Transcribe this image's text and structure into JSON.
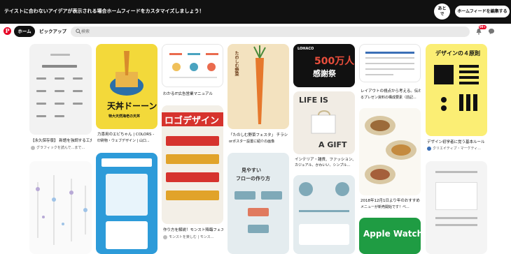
{
  "banner": {
    "message": "テイストに合わないアイデアが表示される場合ホームフィードをカスタマイズしましょう！",
    "later": "あと\nで",
    "edit": "ホームフィードを編集する"
  },
  "nav": {
    "home": "ホーム",
    "pickup": "ピックアップ",
    "search_placeholder": "検索",
    "notifications": "99+"
  },
  "pins": [
    {
      "id": "p1",
      "title": "【永久保存版】 新語を強調する工夫 ...",
      "meta": "グラフィックを読んで...まで...",
      "bg": "#f2f2f2"
    },
    {
      "id": "p2",
      "title": "力喜用のエビちゃん | COLORS -",
      "meta": "印刷物・ウェブデザイン | 山口...",
      "bg": "#f3d93a",
      "art_title": "天丼ドーーン",
      "art_sub": "特大天然海老の天丼"
    },
    {
      "id": "p3",
      "title": "わかるIT広告営業マニュアル",
      "bg": "#ffffff"
    },
    {
      "id": "p4",
      "title": "「たのしむ野菜フェスタ」 チラシ",
      "meta": "orポスター設置に紹介の画像",
      "bg": "#f3e2bf",
      "art_title": "たのしむ野菜"
    },
    {
      "id": "p5",
      "title": "",
      "bg": "#111111",
      "art_title": "500万人",
      "art_sub": "感謝祭",
      "art_brand": "LOHACO"
    },
    {
      "id": "p6",
      "title": "レイアウトの視点から考える。伝わ",
      "meta": "るプレゼン資料の構成要素（前記...",
      "bg": "#ffffff"
    },
    {
      "id": "p7",
      "title": "デザイン初学者に覚う基本ルール",
      "meta": "クリエイティブ・マーケティ...",
      "bg": "#fbee74",
      "art_title": "デザインの４原則"
    },
    {
      "id": "p8",
      "title": "ロゴデザイン",
      "meta": "",
      "bg": "#f3efe7"
    },
    {
      "id": "p9",
      "title": "インテリア・雑貨、ファッション、",
      "meta": "カジュアル、かわいい、シンプル...",
      "bg": "#f1ece4",
      "art_title": "LIFE IS",
      "art_sub": "A GIFT"
    },
    {
      "id": "p10",
      "title": "2018年12月1日より年のおすすめ",
      "meta": "メニューが新売開始です！ベ...",
      "bg": "#faf8f2"
    },
    {
      "id": "p11",
      "title": "作り方を解説！モンスト降臨フェス...",
      "meta": "モンストを楽しむ | モンス...",
      "bg": "#2d9bd9"
    },
    {
      "id": "p12",
      "title": "見やすいフローの作り方",
      "bg": "#e4ecef",
      "art_title": "見やすい",
      "art_sub": "フローの作り方"
    },
    {
      "id": "p13",
      "title": "Apple Watch",
      "bg": "#1f9c43"
    }
  ]
}
